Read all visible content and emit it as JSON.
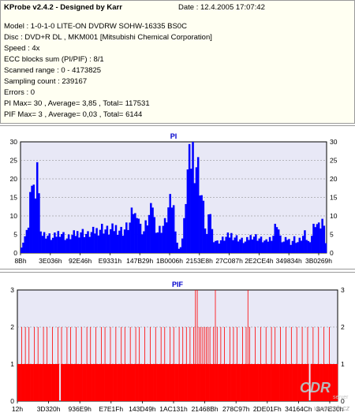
{
  "info": {
    "title": "KProbe v2.4.2 - Designed by Karr",
    "date": "Date : 12.4.2005 17:07:42",
    "lines": [
      "Model : 1-0-1-0 LITE-ON DVDRW SOHW-16335 BS0C",
      "Disc : DVD+R DL , MKM001 [Mitsubishi Chemical Corporation]",
      "Speed : 4x",
      "ECC blocks sum (PI/PIF) : 8/1",
      "Scanned range : 0 - 4173825",
      "Sampling count : 239167",
      "Errors : 0",
      "PI Max= 30 , Average= 3,85 , Total= 117531",
      "PIF Max= 3 , Average= 0,03 , Total= 6144"
    ]
  },
  "colors": {
    "pi_bar": "#0000ff",
    "pif_bar": "#ff0000",
    "plot_bg": "#e8e8f6",
    "title_blue": "#0000cc"
  },
  "watermark": {
    "text": "CDR",
    "subtext": "server",
    "url": "www.cdr.cz"
  },
  "chart_data": [
    {
      "type": "bar",
      "title": "PI",
      "ylim": [
        0,
        30
      ],
      "yticks": [
        "30",
        "25",
        "20",
        "15",
        "10",
        "5",
        "0"
      ],
      "xticks": [
        "8Bh",
        "3E036h",
        "92E46h",
        "E9331h",
        "147B29h",
        "1B0006h",
        "2153E8h",
        "27C087h",
        "2E2CE4h",
        "349834h",
        "3B0269h"
      ],
      "profile": [
        [
          0,
          2
        ],
        [
          2,
          4
        ],
        [
          3,
          8
        ],
        [
          4,
          7
        ],
        [
          5,
          14
        ],
        [
          6,
          22
        ],
        [
          7,
          18
        ],
        [
          8,
          12
        ],
        [
          9,
          28
        ],
        [
          10,
          15
        ],
        [
          11,
          8
        ],
        [
          12,
          5
        ],
        [
          14,
          5
        ],
        [
          18,
          4
        ],
        [
          22,
          6
        ],
        [
          26,
          4
        ],
        [
          30,
          5
        ],
        [
          34,
          6
        ],
        [
          38,
          5
        ],
        [
          42,
          6
        ],
        [
          46,
          7
        ],
        [
          50,
          6
        ],
        [
          54,
          7
        ],
        [
          58,
          6
        ],
        [
          62,
          8
        ],
        [
          64,
          12
        ],
        [
          65,
          10
        ],
        [
          66,
          13
        ],
        [
          68,
          7
        ],
        [
          70,
          6
        ],
        [
          72,
          9
        ],
        [
          74,
          11
        ],
        [
          75,
          14
        ],
        [
          76,
          9
        ],
        [
          78,
          6
        ],
        [
          80,
          7
        ],
        [
          82,
          8
        ],
        [
          84,
          12
        ],
        [
          86,
          14
        ],
        [
          87,
          12
        ],
        [
          88,
          8
        ],
        [
          89,
          3
        ],
        [
          90,
          1
        ],
        [
          91,
          2
        ],
        [
          92,
          4
        ],
        [
          93,
          8
        ],
        [
          94,
          16
        ],
        [
          95,
          22
        ],
        [
          96,
          24
        ],
        [
          97,
          26
        ],
        [
          98,
          28
        ],
        [
          99,
          26
        ],
        [
          100,
          25
        ],
        [
          101,
          23
        ],
        [
          102,
          20
        ],
        [
          103,
          16
        ],
        [
          104,
          12
        ],
        [
          105,
          8
        ],
        [
          106,
          5
        ],
        [
          108,
          12
        ],
        [
          109,
          6
        ],
        [
          110,
          4
        ],
        [
          112,
          3
        ],
        [
          116,
          4
        ],
        [
          120,
          5
        ],
        [
          124,
          4
        ],
        [
          128,
          3
        ],
        [
          132,
          5
        ],
        [
          136,
          4
        ],
        [
          140,
          3
        ],
        [
          144,
          5
        ],
        [
          146,
          9
        ],
        [
          148,
          4
        ],
        [
          150,
          3
        ],
        [
          152,
          4
        ],
        [
          154,
          3
        ],
        [
          156,
          4
        ],
        [
          158,
          3
        ],
        [
          160,
          4
        ],
        [
          162,
          5
        ],
        [
          164,
          3
        ],
        [
          166,
          5
        ],
        [
          168,
          9
        ],
        [
          170,
          7
        ],
        [
          172,
          9
        ],
        [
          174,
          3
        ]
      ]
    },
    {
      "type": "bar",
      "title": "PIF",
      "ylim": [
        0,
        3
      ],
      "yticks": [
        "3",
        "2",
        "1",
        "0"
      ],
      "xticks": [
        "12h",
        "3D320h",
        "936E9h",
        "E7E1Fh",
        "143D49h",
        "1AC131h",
        "21468Bh",
        "278C97h",
        "2DE01Fh",
        "34164Ch",
        "3A7E30h"
      ],
      "ones": [
        [
          0,
          22
        ],
        [
          24,
          78
        ],
        [
          80,
          130
        ],
        [
          131,
          150
        ],
        [
          152,
          160
        ],
        [
          162,
          176
        ]
      ],
      "twos": [
        2,
        4,
        6,
        9,
        11,
        14,
        16,
        19,
        22,
        24,
        27,
        29,
        32,
        35,
        38,
        40,
        43,
        46,
        48,
        51,
        54,
        57,
        59,
        62,
        65,
        67,
        70,
        73,
        76,
        79,
        81,
        84,
        86,
        89,
        91,
        93,
        95,
        97,
        99,
        100,
        101,
        102,
        103,
        104,
        105,
        106,
        108,
        110,
        112,
        114,
        117,
        119,
        121,
        124,
        126,
        128,
        131,
        134,
        137,
        140,
        142,
        145,
        148,
        151,
        154,
        157,
        160,
        163,
        166,
        169,
        172
      ],
      "threes": [
        98,
        99,
        109,
        127
      ]
    }
  ]
}
